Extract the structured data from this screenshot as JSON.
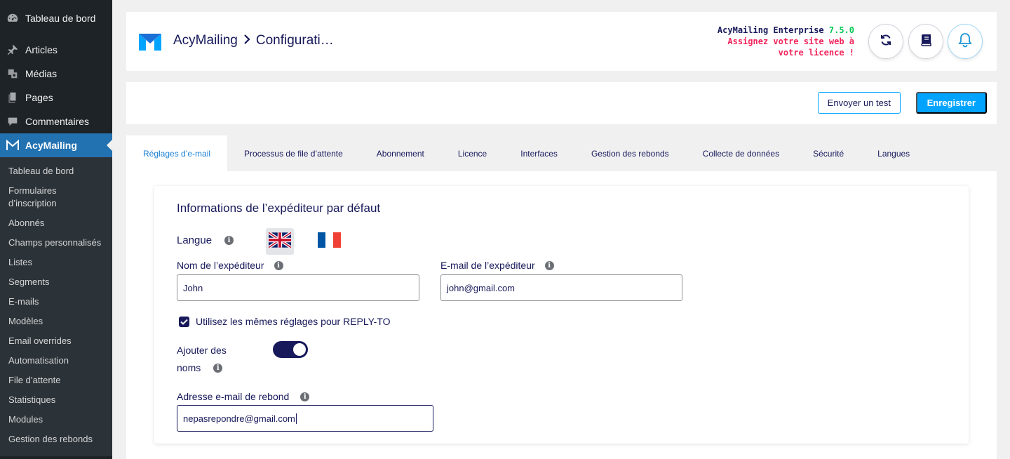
{
  "sidebar": {
    "top_items": [
      {
        "label": "Tableau de bord",
        "icon": "dashboard-icon"
      },
      {
        "label": "Articles",
        "icon": "pin-icon"
      },
      {
        "label": "Médias",
        "icon": "media-icon"
      },
      {
        "label": "Pages",
        "icon": "pages-icon"
      },
      {
        "label": "Commentaires",
        "icon": "comments-icon"
      },
      {
        "label": "AcyMailing",
        "icon": "acymailing-icon"
      }
    ],
    "sub_items": [
      "Tableau de bord",
      "Formulaires d’inscription",
      "Abonnés",
      "Champs personnalisés",
      "Listes",
      "Segments",
      "E-mails",
      "Modèles",
      "Email overrides",
      "Automatisation",
      "File d’attente",
      "Statistiques",
      "Modules",
      "Gestion des rebonds"
    ]
  },
  "header": {
    "app_name": "AcyMailing",
    "page_name": "Configurati…",
    "edition": "AcyMailing Enterprise",
    "version": "7.5.0",
    "license_warning": "Assignez votre site web à votre licence !"
  },
  "actions": {
    "test_label": "Envoyer un test",
    "save_label": "Enregistrer"
  },
  "tabs": [
    {
      "label": "Réglages d’e-mail",
      "active": true
    },
    {
      "label": "Processus de file d’attente"
    },
    {
      "label": "Abonnement"
    },
    {
      "label": "Licence"
    },
    {
      "label": "Interfaces"
    },
    {
      "label": "Gestion des rebonds"
    },
    {
      "label": "Collecte de données"
    },
    {
      "label": "Sécurité"
    },
    {
      "label": "Langues"
    }
  ],
  "form": {
    "title": "Informations de l’expéditeur par défaut",
    "language_label": "Langue",
    "sender_name_label": "Nom de l’expéditeur",
    "sender_name_value": "John",
    "sender_email_label": "E-mail de l’expéditeur",
    "sender_email_value": "john@gmail.com",
    "reply_to_label": "Utilisez les mêmes réglages pour REPLY-TO",
    "reply_to_checked": true,
    "add_names_label_1": "Ajouter des",
    "add_names_label_2": "noms",
    "add_names_on": true,
    "bounce_label": "Adresse e-mail de rebond",
    "bounce_value": "nepasrepondre@gmail.com"
  },
  "colors": {
    "sidebar_bg": "#1d2327",
    "accent": "#00a4ff",
    "brand_navy": "#17195a",
    "version_green": "#00c853",
    "warning_red": "#f2245c"
  }
}
